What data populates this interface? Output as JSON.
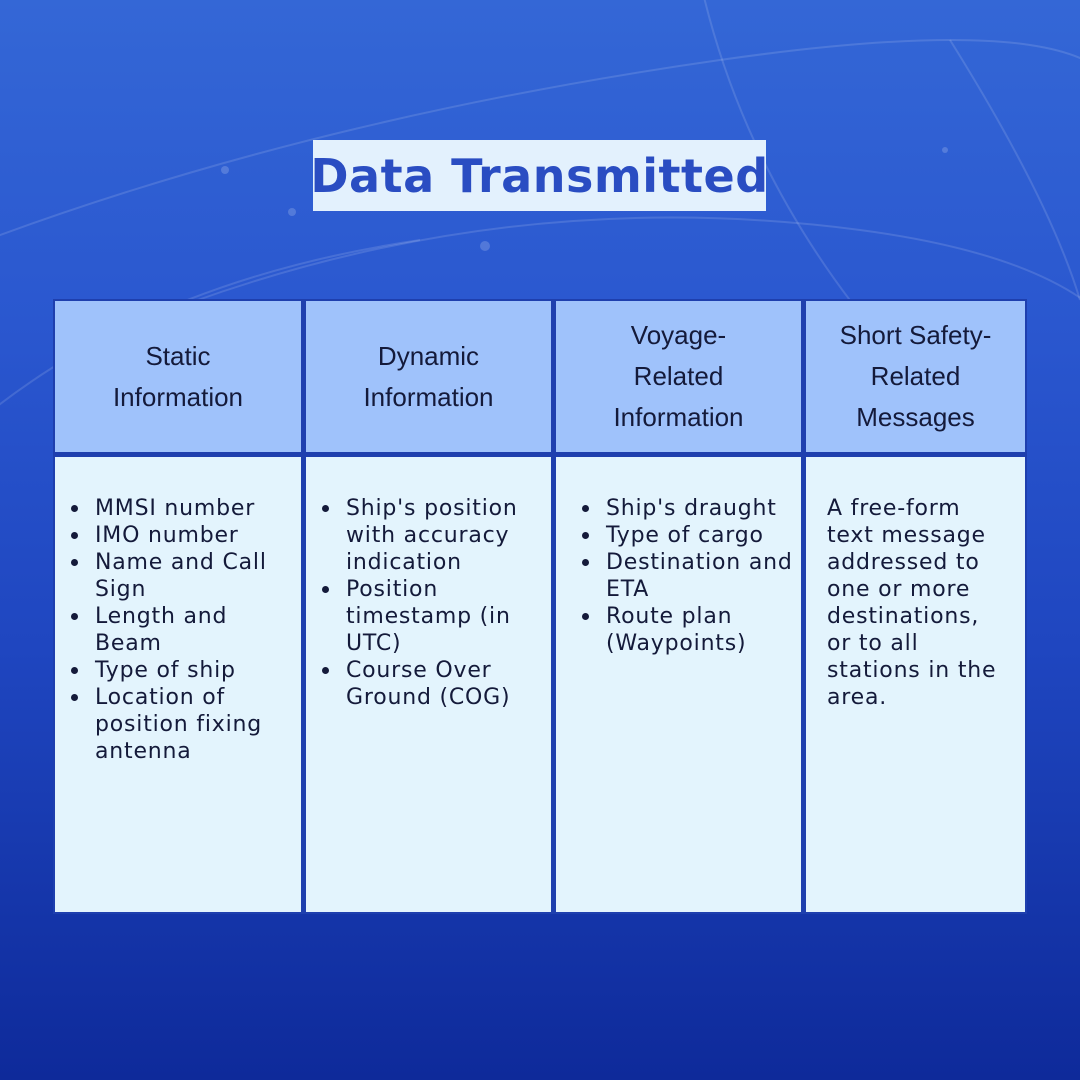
{
  "title": "Data Transmitted",
  "columns": [
    {
      "header_lines": [
        "Static",
        "Information"
      ],
      "items": [
        "MMSI number",
        "IMO number",
        "Name and Call Sign",
        "Length and Beam",
        "Type of ship",
        "Location of position fixing antenna"
      ]
    },
    {
      "header_lines": [
        "Dynamic",
        "Information"
      ],
      "items": [
        "Ship's position with accuracy indication",
        "Position timestamp (in UTC)",
        "Course Over Ground (COG)"
      ]
    },
    {
      "header_lines": [
        "Voyage-",
        "Related",
        "Information"
      ],
      "items": [
        "Ship's draught",
        "Type of cargo",
        "Destination and ETA",
        "Route plan (Waypoints)"
      ]
    },
    {
      "header_lines": [
        "Short Safety-",
        "Related",
        "Messages"
      ],
      "text": "A free-form text message addressed to one or more destinations, or to all stations in the area."
    }
  ],
  "colors": {
    "background_top": "#3467d6",
    "background_bottom": "#0e2a9a",
    "title_box": "#e3f1fd",
    "title_text": "#2a4dc2",
    "header_cell": "#9fc2fb",
    "body_cell": "#e3f4fd",
    "text": "#141a3a"
  }
}
